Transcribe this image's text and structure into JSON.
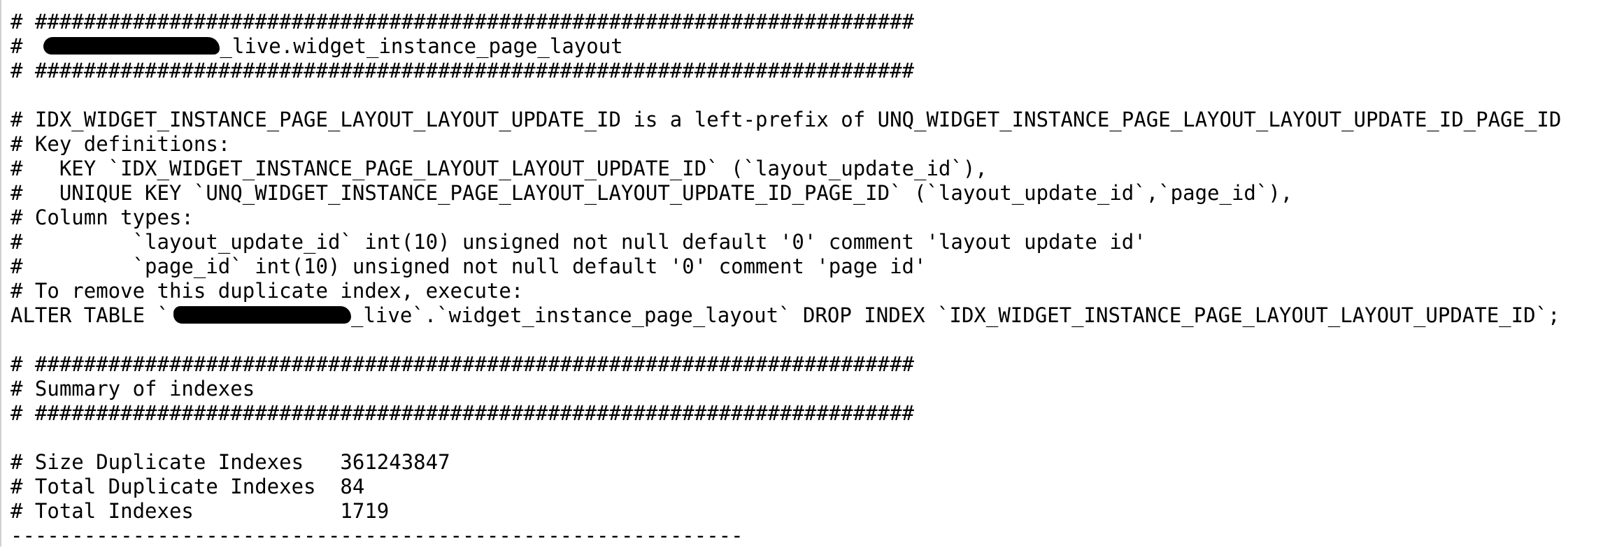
{
  "output": {
    "lines": {
      "l01": "# ########################################################################",
      "l02_prefix": "#",
      "l02_suffix": "_live.widget_instance_page_layout",
      "l03": "# ########################################################################",
      "l04": "",
      "l05": "# IDX_WIDGET_INSTANCE_PAGE_LAYOUT_LAYOUT_UPDATE_ID is a left-prefix of UNQ_WIDGET_INSTANCE_PAGE_LAYOUT_LAYOUT_UPDATE_ID_PAGE_ID",
      "l06": "# Key definitions:",
      "l07": "#   KEY `IDX_WIDGET_INSTANCE_PAGE_LAYOUT_LAYOUT_UPDATE_ID` (`layout_update_id`),",
      "l08": "#   UNIQUE KEY `UNQ_WIDGET_INSTANCE_PAGE_LAYOUT_LAYOUT_UPDATE_ID_PAGE_ID` (`layout_update_id`,`page_id`),",
      "l09": "# Column types:",
      "l10": "#         `layout_update_id` int(10) unsigned not null default '0' comment 'layout update id'",
      "l11": "#         `page_id` int(10) unsigned not null default '0' comment 'page id'",
      "l12": "# To remove this duplicate index, execute:",
      "l13_prefix": "ALTER TABLE `",
      "l13_suffix": "_live`.`widget_instance_page_layout` DROP INDEX `IDX_WIDGET_INSTANCE_PAGE_LAYOUT_LAYOUT_UPDATE_ID`;",
      "l14": "",
      "l15": "# ########################################################################",
      "l16": "# Summary of indexes",
      "l17": "# ########################################################################",
      "l18": "",
      "l19": "# Size Duplicate Indexes   361243847",
      "l20": "# Total Duplicate Indexes  84",
      "l21": "# Total Indexes            1719",
      "l22": "------------------------------------------------------------"
    }
  }
}
